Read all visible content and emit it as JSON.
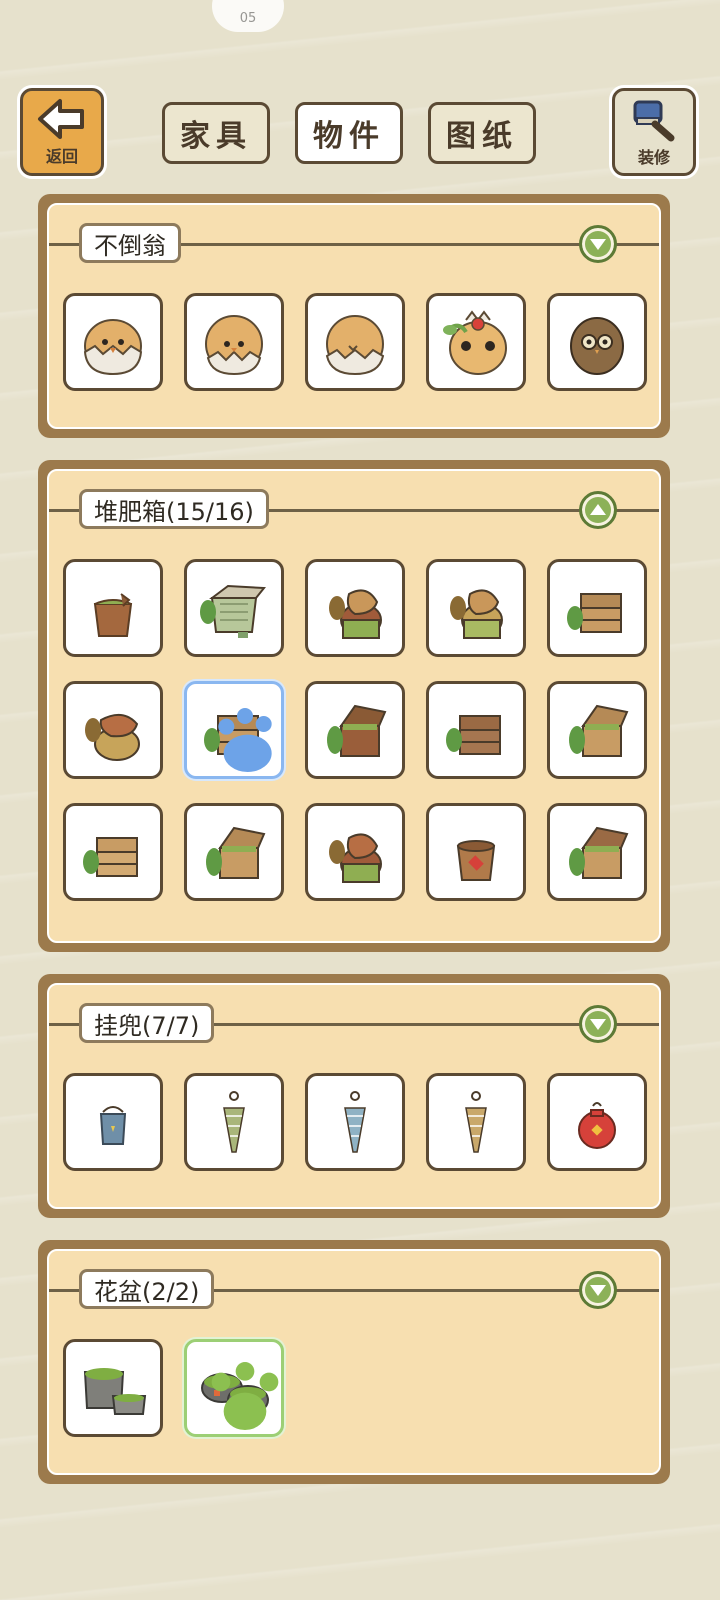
{
  "status": {
    "indicator": "05"
  },
  "header": {
    "back_label": "返回",
    "decorate_label": "装修",
    "tabs": [
      "家具",
      "物件",
      "图纸"
    ],
    "active_tab": "物件"
  },
  "colors": {
    "panel_frame": "#9c7a4c",
    "panel_fill": "#f7dfb0",
    "toggle_green": "#8cb158",
    "back_button": "#e8a94a",
    "selected_blue": "#8ab7f0",
    "selected_green": "#9ccf75"
  },
  "sections": [
    {
      "title": "不倒翁",
      "toggle": "expand",
      "items": [
        "owl-egg-tumbler",
        "chick-egg-tumbler",
        "cracked-egg-tumbler",
        "panda-berry-tumbler",
        "brown-owl-tumbler"
      ]
    },
    {
      "title": "堆肥箱(15/16)",
      "toggle": "collapse",
      "items": [
        "wooden-bucket",
        "mesh-compost-bin",
        "stump-compost-sack",
        "stump-compost-sack",
        "wooden-crate-stack",
        "stump-compost-sack",
        "wooden-crate-stack",
        "open-compost-crate",
        "wooden-crate-stack",
        "open-compost-crate",
        "wooden-crate-stack",
        "open-compost-crate",
        "stump-compost-sack",
        "clay-compost-pot",
        "open-compost-crate"
      ],
      "selected_index": 6
    },
    {
      "title": "挂兜(7/7)",
      "toggle": "expand",
      "items": [
        "blue-hanging-bucket",
        "green-hanging-net",
        "blue-hanging-net",
        "brown-hanging-net",
        "red-lucky-pouch"
      ]
    },
    {
      "title": "花盆(2/2)",
      "toggle": "expand",
      "items": [
        "stone-moss-planter",
        "twin-moss-pots"
      ],
      "selected_index": 1
    }
  ]
}
